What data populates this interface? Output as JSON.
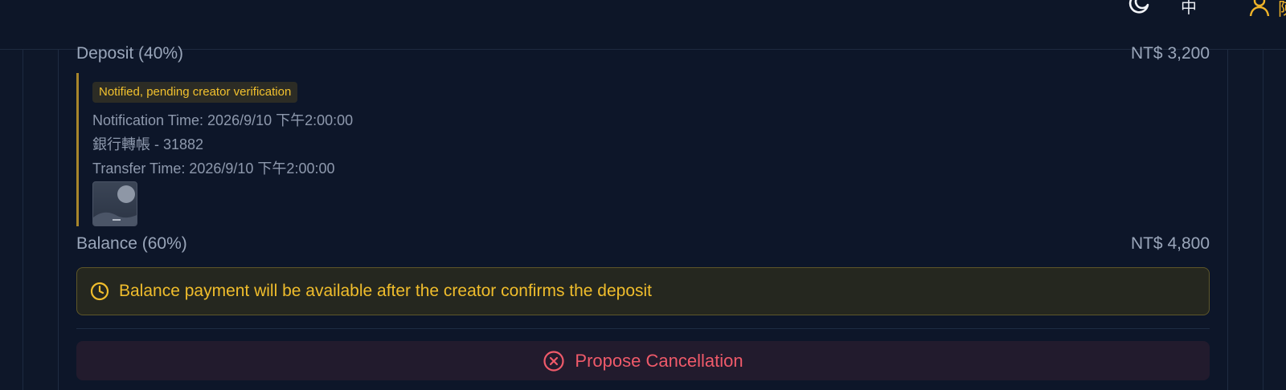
{
  "header": {
    "language_label": "中",
    "user_extra": "陳"
  },
  "payment": {
    "deposit": {
      "label": "Deposit (40%)",
      "amount": "NT$ 3,200",
      "status": "Notified, pending creator verification",
      "notification_time": "Notification Time: 2026/9/10 下午2:00:00",
      "bank_info": "銀行轉帳 - 31882",
      "transfer_time": "Transfer Time: 2026/9/10 下午2:00:00"
    },
    "balance": {
      "label": "Balance (60%)",
      "amount": "NT$ 4,800"
    },
    "notice": "Balance payment will be available after the creator confirms the deposit",
    "cancel_label": "Propose Cancellation"
  },
  "colors": {
    "background": "#0e1729",
    "accent_yellow": "#f0bd2c",
    "danger": "#ef5a6a"
  }
}
